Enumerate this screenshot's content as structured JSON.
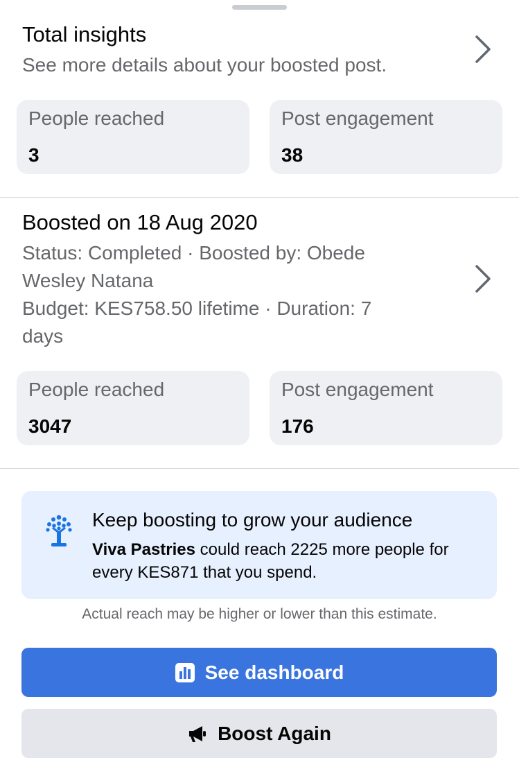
{
  "total_insights": {
    "title": "Total insights",
    "subtitle": "See more details about your boosted post.",
    "stats": [
      {
        "label": "People reached",
        "value": "3"
      },
      {
        "label": "Post engagement",
        "value": "38"
      }
    ]
  },
  "boost": {
    "title": "Boosted on 18 Aug 2020",
    "status_line": "Status: Completed · Boosted by: Obede Wesley Natana",
    "budget_line": "Budget: KES758.50 lifetime · Duration: 7 days",
    "stats": [
      {
        "label": "People reached",
        "value": "3047"
      },
      {
        "label": "Post engagement",
        "value": "176"
      }
    ]
  },
  "promo": {
    "icon": "tree-icon",
    "title": "Keep boosting to grow your audience",
    "page_name": "Viva Pastries",
    "text": " could reach 2225 more people for every KES871 that you spend."
  },
  "disclaimer": "Actual reach may be higher or lower than this estimate.",
  "buttons": {
    "dashboard": {
      "label": "See dashboard",
      "icon": "bar-chart-icon"
    },
    "boost_again": {
      "label": "Boost Again",
      "icon": "megaphone-icon"
    }
  },
  "colors": {
    "primary": "#3a75df",
    "promo_bg": "#e7f0fe",
    "stat_bg": "#eff0f4",
    "secondary_text": "#65676b"
  }
}
